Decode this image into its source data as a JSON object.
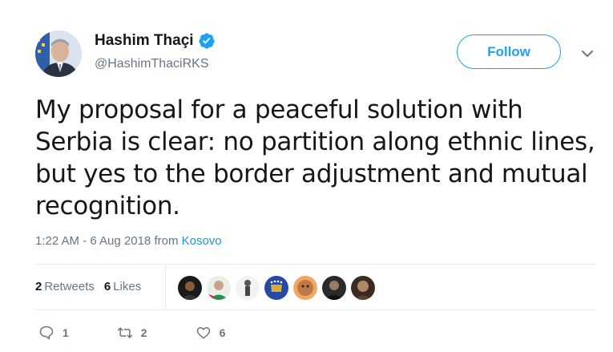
{
  "author": {
    "display_name": "Hashim Thaçi",
    "handle": "@HashimThaciRKS",
    "verified_icon": "verified-badge-icon"
  },
  "follow_label": "Follow",
  "tweet": {
    "text": "My proposal for a peaceful solution with Serbia is clear: no partition along ethnic lines, but yes to the border adjustment and mutual recognition.",
    "timestamp": "1:22 AM - 6 Aug 2018 from ",
    "source": "Kosovo"
  },
  "stats": {
    "retweets_count": "2",
    "retweets_label": "Retweets",
    "likes_count": "6",
    "likes_label": "Likes"
  },
  "actions": {
    "reply_count": "1",
    "retweet_count": "2",
    "like_count": "6"
  },
  "colors": {
    "accent": "#1da1f2",
    "text": "#14171a",
    "muted": "#657786",
    "divider": "#e6ecf0"
  }
}
